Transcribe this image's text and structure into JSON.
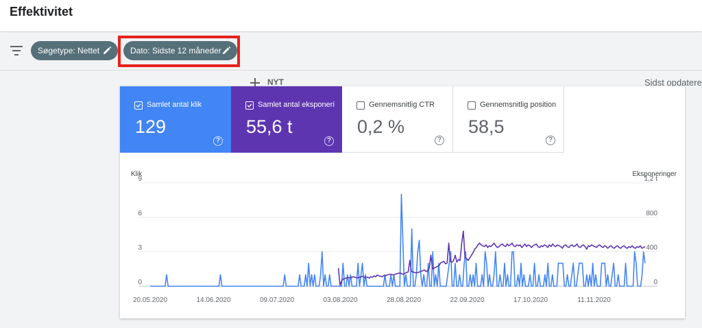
{
  "header": {
    "title": "Effektivitet"
  },
  "filters": {
    "chips": [
      {
        "label": "Søgetype: Nettet",
        "icon": "edit-icon"
      },
      {
        "label": "Dato: Sidste 12 måneder",
        "icon": "edit-icon"
      }
    ],
    "add_label": "NYT",
    "updated_text": "Sidst opdateret",
    "highlight_color": "#e8211b"
  },
  "metrics": [
    {
      "label": "Samlet antal klik",
      "value": "129",
      "checked": true,
      "color": "#4285f4"
    },
    {
      "label": "Samlet antal eksponeringer",
      "value": "55,6 t",
      "checked": true,
      "color": "#5e35b1"
    },
    {
      "label": "Gennemsnitlig CTR",
      "value": "0,2 %",
      "checked": false,
      "color": "#ffffff"
    },
    {
      "label": "Gennemsnitlig position",
      "value": "58,5",
      "checked": false,
      "color": "#ffffff"
    }
  ],
  "chart_data": {
    "type": "line",
    "ylabel": "Klik",
    "ylabel_right": "Eksponeringer",
    "ylim": [
      0,
      9
    ],
    "ylim_right": [
      0,
      1200
    ],
    "yticks": [
      "0",
      "3",
      "6",
      "9"
    ],
    "yticks_right": [
      "0",
      "400",
      "800",
      "1,2 t"
    ],
    "xticks": [
      "20.05.2020",
      "14.06.2020",
      "09.07.2020",
      "03.08.2020",
      "28.08.2020",
      "22.09.2020",
      "17.10.2020",
      "11.11.2020"
    ],
    "grid": true,
    "series": [
      {
        "name": "Samlet antal klik",
        "axis": "left",
        "color": "#4285f4",
        "values": [
          0,
          0,
          0,
          0,
          0,
          0,
          0,
          0,
          0,
          0,
          0,
          1,
          0,
          0,
          0,
          0,
          0,
          0,
          0,
          0,
          0,
          0,
          0,
          0,
          0,
          0,
          0,
          0,
          0,
          0,
          0,
          0,
          0,
          0,
          0,
          0,
          0,
          0,
          0,
          0,
          0,
          0,
          0,
          0,
          0,
          0,
          0,
          1,
          0,
          0,
          0,
          0,
          0,
          0,
          0,
          0,
          0,
          0,
          0,
          0,
          0,
          0,
          0,
          0,
          0,
          0,
          0,
          0,
          0,
          0,
          0,
          0,
          0,
          0,
          0,
          0,
          0,
          0,
          0,
          0,
          0,
          0,
          0,
          0,
          0,
          0,
          0,
          0,
          0,
          0,
          1,
          0,
          0,
          0,
          0,
          0,
          0,
          0,
          0,
          0,
          1,
          0,
          0,
          0,
          1,
          0,
          2,
          0,
          1,
          0,
          1,
          0,
          0,
          0,
          1,
          3,
          0,
          1,
          0,
          0,
          1,
          0,
          0,
          0,
          0,
          0,
          0,
          0,
          0,
          2,
          0,
          0,
          1,
          0,
          1,
          0,
          0,
          0,
          0,
          2,
          0,
          1,
          2,
          0,
          1,
          0,
          0,
          0,
          0,
          0,
          0,
          0,
          0,
          0,
          0,
          0,
          0,
          1,
          0,
          0,
          0,
          1,
          0,
          1,
          0,
          0,
          0,
          0,
          8,
          4,
          0,
          1,
          0,
          0,
          0,
          5,
          0,
          0,
          1,
          3,
          4,
          1,
          0,
          1,
          0,
          0,
          2,
          0,
          0,
          3,
          0,
          1,
          0,
          2,
          0,
          0,
          0,
          0,
          0,
          1,
          2,
          3,
          0,
          0,
          2,
          0,
          0,
          1,
          0,
          0,
          2,
          3,
          0,
          0,
          1,
          0,
          1,
          0,
          2,
          0,
          0,
          0,
          1,
          0,
          3,
          2,
          0,
          1,
          0,
          0,
          1,
          3,
          0,
          0,
          1,
          0,
          0,
          2,
          0,
          1,
          0,
          0,
          3,
          3,
          0,
          0,
          1,
          0,
          2,
          0,
          1,
          0,
          0,
          0,
          1,
          0,
          0,
          2,
          0,
          0,
          1,
          0,
          0,
          0,
          1,
          0,
          2,
          0,
          0,
          1,
          0,
          0,
          0,
          2,
          2,
          2,
          2,
          0,
          0,
          1,
          0,
          0,
          1,
          2,
          0,
          0,
          1,
          2,
          2,
          2,
          0,
          0,
          1,
          0,
          1,
          0,
          2,
          0,
          1,
          0,
          0,
          0,
          2,
          2,
          2,
          0,
          1,
          0,
          0,
          1,
          2,
          0,
          0,
          1,
          0,
          0,
          0,
          0,
          2,
          0,
          0,
          0,
          0,
          0,
          3,
          2,
          0,
          0,
          0,
          1,
          3,
          2
        ]
      },
      {
        "name": "Samlet antal eksponeringer",
        "axis": "right",
        "color": "#5e35b1",
        "values": [
          null,
          null,
          null,
          null,
          null,
          null,
          null,
          null,
          null,
          null,
          null,
          null,
          null,
          null,
          null,
          null,
          null,
          null,
          null,
          null,
          null,
          null,
          null,
          null,
          null,
          null,
          null,
          null,
          null,
          null,
          null,
          null,
          null,
          null,
          null,
          null,
          null,
          null,
          null,
          null,
          null,
          null,
          null,
          null,
          null,
          null,
          null,
          null,
          null,
          null,
          null,
          null,
          null,
          null,
          null,
          null,
          null,
          null,
          null,
          null,
          null,
          null,
          null,
          null,
          null,
          null,
          null,
          null,
          null,
          null,
          null,
          null,
          null,
          null,
          null,
          null,
          null,
          null,
          null,
          null,
          null,
          null,
          null,
          null,
          null,
          null,
          null,
          null,
          null,
          null,
          null,
          null,
          null,
          null,
          null,
          null,
          null,
          null,
          null,
          null,
          null,
          null,
          null,
          null,
          null,
          null,
          null,
          null,
          null,
          null,
          null,
          null,
          null,
          null,
          null,
          null,
          210,
          10,
          60,
          85,
          90,
          95,
          100,
          98,
          100,
          110,
          105,
          100,
          98,
          105,
          110,
          115,
          105,
          100,
          105,
          95,
          110,
          105,
          120,
          110,
          130,
          120,
          115,
          110,
          125,
          120,
          130,
          135,
          140,
          135,
          130,
          140,
          145,
          150,
          155,
          145,
          140,
          150,
          160,
          165,
          300,
          170,
          165,
          160,
          155,
          160,
          165,
          175,
          180,
          190,
          170,
          180,
          210,
          360,
          200,
          210,
          220,
          230,
          240,
          270,
          280,
          290,
          260,
          270,
          500,
          290,
          280,
          300,
          360,
          280,
          310,
          300,
          500,
          640,
          340,
          320,
          300,
          330,
          360,
          390,
          430,
          450,
          480,
          500,
          480,
          470,
          460,
          480,
          450,
          470,
          460,
          480,
          500,
          470,
          450,
          460,
          480,
          490,
          470,
          460,
          490,
          470,
          480,
          500,
          470,
          460,
          480,
          470,
          480,
          450,
          470,
          490,
          460,
          480,
          470,
          450,
          470,
          480,
          490,
          460,
          450,
          470,
          460,
          480,
          470,
          450,
          480,
          460,
          490,
          470,
          460,
          480,
          470,
          460,
          440,
          470,
          480,
          460,
          450,
          470,
          480,
          460,
          470,
          490,
          460,
          450,
          470,
          480,
          460,
          430,
          470,
          460,
          480,
          470,
          460,
          450,
          470,
          480,
          460,
          450,
          470,
          460,
          440,
          460,
          470,
          450,
          440,
          460,
          470,
          450,
          440,
          460,
          470,
          450,
          440,
          460,
          450,
          470,
          450,
          440,
          460,
          450,
          470,
          440,
          450,
          460
        ]
      }
    ]
  }
}
